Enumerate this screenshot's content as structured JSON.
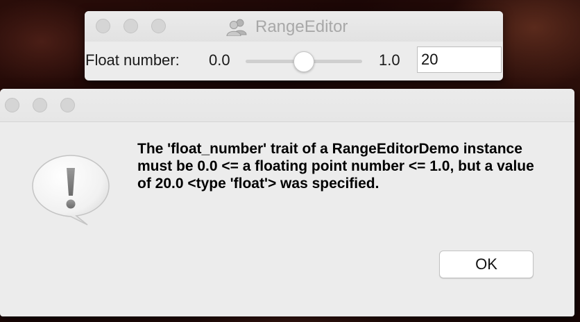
{
  "range_window": {
    "title": "RangeEditor",
    "app_icon": "users-icon",
    "field_label": "Float number:",
    "range_low": "0.0",
    "range_high": "1.0",
    "slider_level": 0.5,
    "input_value": "20"
  },
  "alert": {
    "icon": "exclamation-speech-bubble-icon",
    "message": "The 'float_number' trait of a RangeEditorDemo instance must be 0.0 <= a floating point number <= 1.0, but a value of 20.0 <type 'float'> was specified.",
    "ok_label": "OK"
  }
}
